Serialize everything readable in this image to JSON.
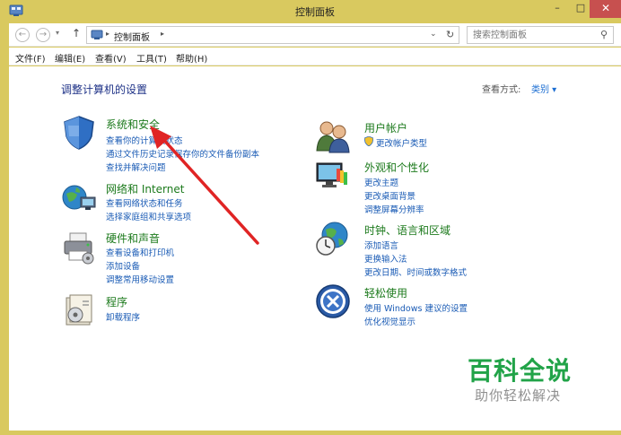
{
  "window": {
    "title": "控制面板",
    "controls": {
      "minimize": "–",
      "maximize": "□",
      "close": "✕"
    }
  },
  "toolbar": {
    "address_path": "控制面板",
    "search_placeholder": "搜索控制面板"
  },
  "menu": [
    "文件(F)",
    "编辑(E)",
    "查看(V)",
    "工具(T)",
    "帮助(H)"
  ],
  "content": {
    "heading": "调整计算机的设置",
    "view_by_label": "查看方式:",
    "view_by_value": "类别 ▾",
    "categories": [
      {
        "title": "系统和安全",
        "icon": "shield-icon",
        "links": [
          "查看你的计算机状态",
          "通过文件历史记录保存你的文件备份副本",
          "查找并解决问题"
        ]
      },
      {
        "title": "网络和 Internet",
        "icon": "network-globe-icon",
        "links": [
          "查看网络状态和任务",
          "选择家庭组和共享选项"
        ]
      },
      {
        "title": "硬件和声音",
        "icon": "printer-icon",
        "links": [
          "查看设备和打印机",
          "添加设备",
          "调整常用移动设置"
        ]
      },
      {
        "title": "程序",
        "icon": "programs-icon",
        "links": [
          "卸载程序"
        ]
      },
      {
        "title": "用户帐户",
        "icon": "users-icon",
        "links": [
          "更改帐户类型"
        ]
      },
      {
        "title": "外观和个性化",
        "icon": "display-paint-icon",
        "links": [
          "更改主题",
          "更改桌面背景",
          "调整屏幕分辨率"
        ]
      },
      {
        "title": "时钟、语言和区域",
        "icon": "clock-globe-icon",
        "links": [
          "添加语言",
          "更换输入法",
          "更改日期、时间或数字格式"
        ]
      },
      {
        "title": "轻松使用",
        "icon": "ease-of-access-icon",
        "links": [
          "使用 Windows 建议的设置",
          "优化视觉显示"
        ]
      }
    ]
  },
  "watermark": {
    "title": "百科全说",
    "subtitle": "助你轻松解决"
  },
  "colors": {
    "titlebar": "#d9c95f",
    "close": "#c7504f",
    "category_title": "#1c7a1c",
    "link": "#1a5bb5",
    "arrow": "#e02424",
    "watermark": "#21a348"
  }
}
